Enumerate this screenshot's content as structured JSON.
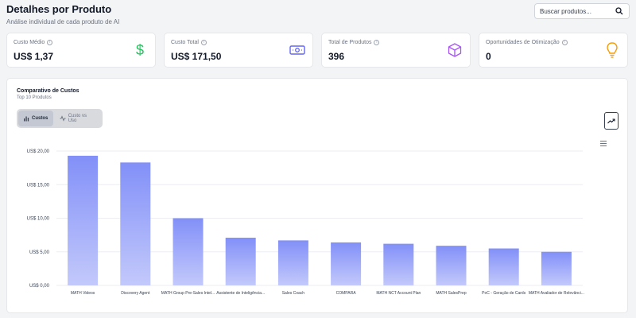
{
  "header": {
    "title": "Detalhes por Produto",
    "subtitle": "Análise individual de cada produto de AI"
  },
  "search": {
    "placeholder": "Buscar produtos..."
  },
  "kpis": [
    {
      "label": "Custo Médio",
      "value": "US$ 1,37",
      "icon": "dollar-icon",
      "color": "#22c55e"
    },
    {
      "label": "Custo Total",
      "value": "US$ 171,50",
      "icon": "cash-icon",
      "color": "#6366f1"
    },
    {
      "label": "Total de Produtos",
      "value": "396",
      "icon": "box-icon",
      "color": "#a855f7"
    },
    {
      "label": "Oportunidades de Otimização",
      "value": "0",
      "icon": "lightbulb-icon",
      "color": "#f59e0b"
    }
  ],
  "chart_section": {
    "title": "Comparativo de Custos",
    "subtitle": "Top 10 Produtos",
    "toggle": {
      "active_label": "Custos",
      "inactive_label": "Custo vs Uso"
    }
  },
  "colors": {
    "bar_top": "#8290f8",
    "bar_bottom": "#c3c9fb",
    "accent": "#6366f1"
  },
  "chart_data": {
    "type": "bar",
    "categories": [
      "MATH Videos",
      "Discovery Agent",
      "MATH Group Pre-Sales Intel...",
      "Assistente de Inteligência...",
      "Sales Coach",
      "COMPARA",
      "MATH NCT Account Plan",
      "MATH SalesPrep",
      "PoC - Geração de Cards",
      "MATH Avaliador de Relevânci..."
    ],
    "values": [
      19.3,
      18.3,
      10.0,
      7.1,
      6.7,
      6.4,
      6.2,
      5.9,
      5.5,
      5.0
    ],
    "y_ticks": [
      "US$ 0,00",
      "US$ 5,00",
      "US$ 10,00",
      "US$ 15,00",
      "US$ 20,00"
    ],
    "ylim": [
      0,
      20
    ],
    "grid": true
  }
}
